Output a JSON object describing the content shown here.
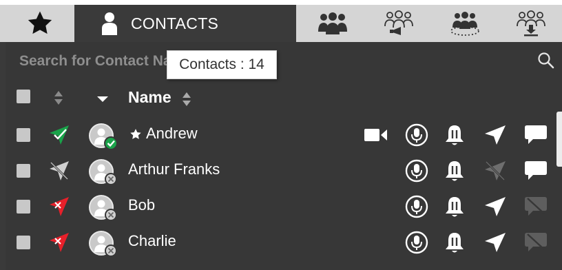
{
  "tabs": {
    "contacts_label": "CONTACTS",
    "icons": [
      "star-icon",
      "person-icon",
      "group-icon",
      "group-broadcast-icon",
      "group-ring-icon",
      "group-download-icon"
    ]
  },
  "search": {
    "placeholder": "Search for Contact Name or Number"
  },
  "tooltip": {
    "text": "Contacts : 14"
  },
  "header": {
    "name_label": "Name"
  },
  "contacts": [
    {
      "name": "Andrew",
      "favorite": true,
      "location_status": "green",
      "presence": "online",
      "has_video": true,
      "has_location": true,
      "message_enabled": true
    },
    {
      "name": "Arthur Franks",
      "favorite": false,
      "location_status": "disabled",
      "presence": "offline",
      "has_video": false,
      "has_location": false,
      "message_enabled": true
    },
    {
      "name": "Bob",
      "favorite": false,
      "location_status": "red",
      "presence": "offline",
      "has_video": false,
      "has_location": true,
      "message_enabled": false
    },
    {
      "name": "Charlie",
      "favorite": false,
      "location_status": "red",
      "presence": "offline",
      "has_video": false,
      "has_location": true,
      "message_enabled": false
    }
  ],
  "colors": {
    "accent_green": "#1aa34a",
    "accent_red": "#e8202a",
    "panel_bg": "#373737",
    "tab_strip": "#d5d5d5"
  }
}
